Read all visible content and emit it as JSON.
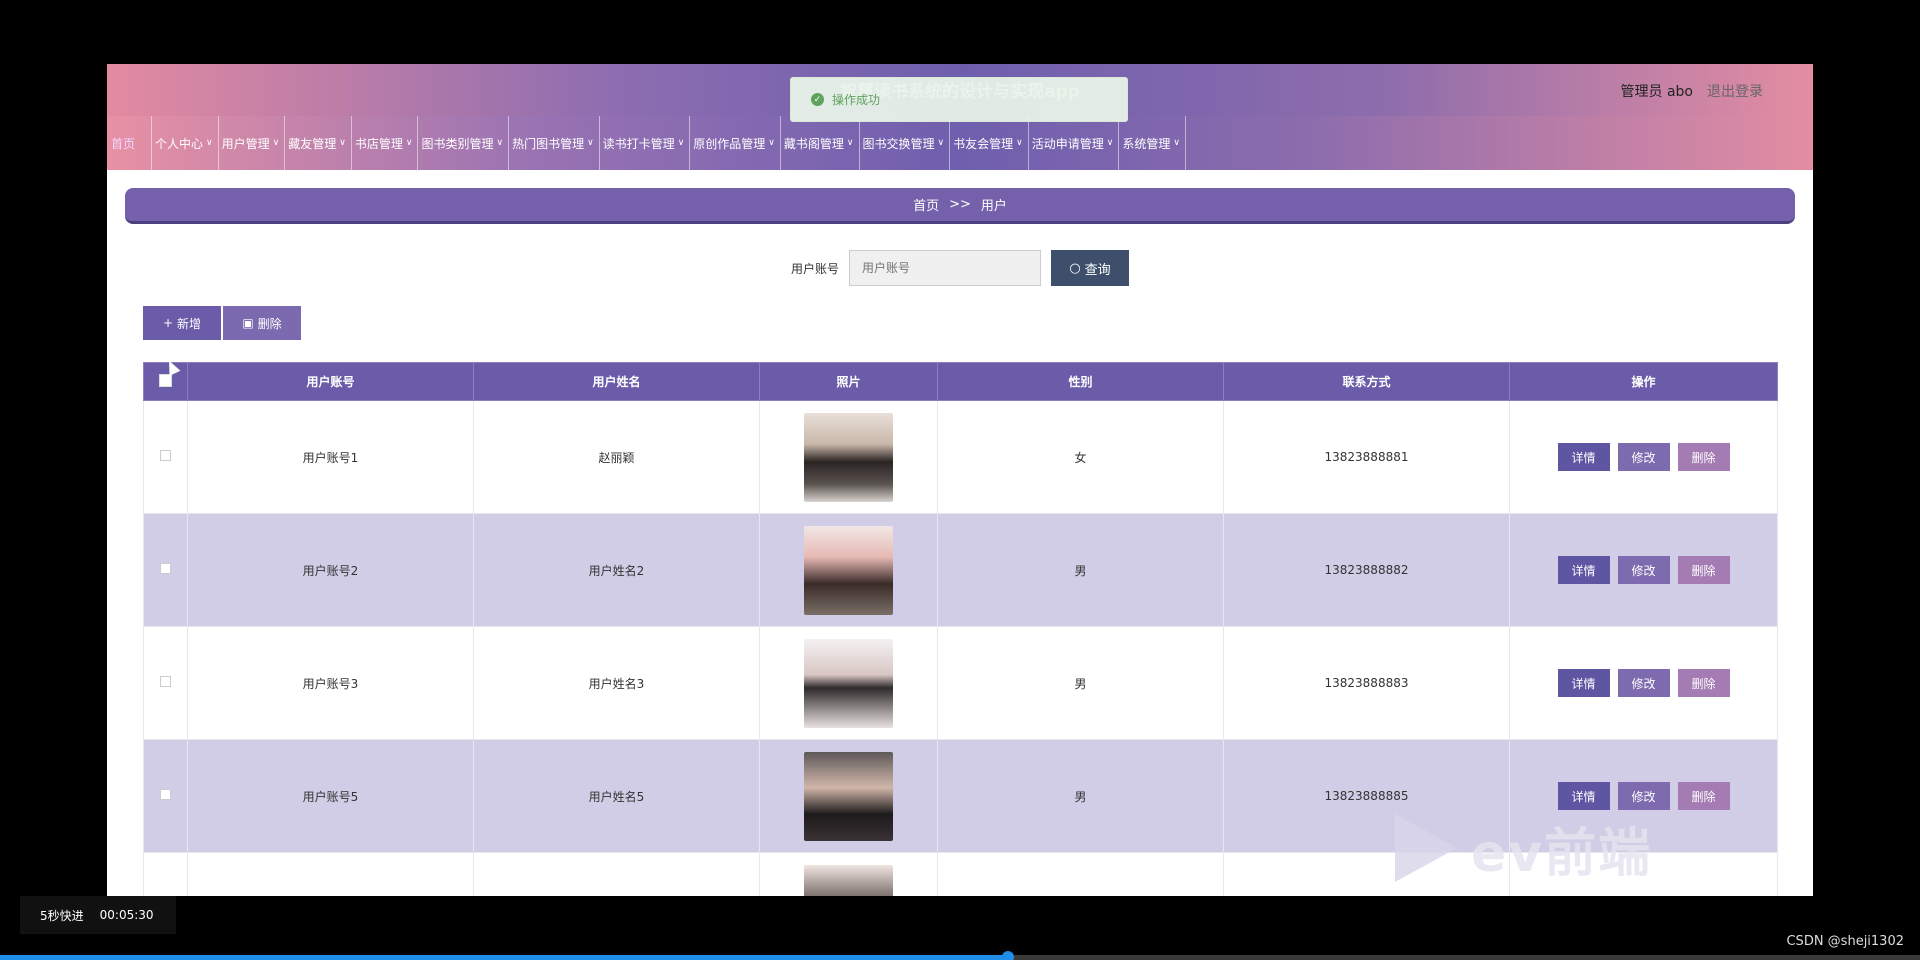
{
  "header": {
    "title": "智慧读书系统的设计与实现app",
    "admin_label": "管理员 abo",
    "logout_label": "退出登录"
  },
  "nav": {
    "items": [
      {
        "label": "首页",
        "has_menu": false
      },
      {
        "label": "个人中心",
        "has_menu": true
      },
      {
        "label": "用户管理",
        "has_menu": true
      },
      {
        "label": "藏友管理",
        "has_menu": true
      },
      {
        "label": "书店管理",
        "has_menu": true
      },
      {
        "label": "图书类别管理",
        "has_menu": true
      },
      {
        "label": "热门图书管理",
        "has_menu": true
      },
      {
        "label": "读书打卡管理",
        "has_menu": true
      },
      {
        "label": "原创作品管理",
        "has_menu": true
      },
      {
        "label": "藏书阁管理",
        "has_menu": true
      },
      {
        "label": "图书交换管理",
        "has_menu": true
      },
      {
        "label": "书友会管理",
        "has_menu": true
      },
      {
        "label": "活动申请管理",
        "has_menu": true
      },
      {
        "label": "系统管理",
        "has_menu": true
      }
    ]
  },
  "breadcrumb": {
    "home": "首页",
    "separator": ">>",
    "current": "用户"
  },
  "search": {
    "label": "用户账号",
    "placeholder": "用户账号",
    "button_label": "查询"
  },
  "actions": {
    "add_label": "新增",
    "delete_label": "删除"
  },
  "table": {
    "columns": [
      "用户账号",
      "用户姓名",
      "照片",
      "性别",
      "联系方式",
      "操作"
    ],
    "rows": [
      {
        "account": "用户账号1",
        "name": "赵丽颖",
        "gender": "女",
        "phone": "13823888881"
      },
      {
        "account": "用户账号2",
        "name": "用户姓名2",
        "gender": "男",
        "phone": "13823888882"
      },
      {
        "account": "用户账号3",
        "name": "用户姓名3",
        "gender": "男",
        "phone": "13823888883"
      },
      {
        "account": "用户账号5",
        "name": "用户姓名5",
        "gender": "男",
        "phone": "13823888885"
      },
      {
        "account": "",
        "name": "",
        "gender": "",
        "phone": ""
      }
    ],
    "row_actions": {
      "detail": "详情",
      "edit": "修改",
      "delete": "删除"
    }
  },
  "toast": {
    "message": "操作成功"
  },
  "video": {
    "speed_label": "5秒快进",
    "timestamp": "00:05:30",
    "progress": 0.525
  },
  "watermark": {
    "text": "ev前端"
  },
  "credit": "CSDN @sheji1302",
  "colors": {
    "primary": "#6a5ca8",
    "search_button": "#3d4f6b",
    "row_alt": "#d2cde6",
    "toast_green": "#5fa25c"
  }
}
